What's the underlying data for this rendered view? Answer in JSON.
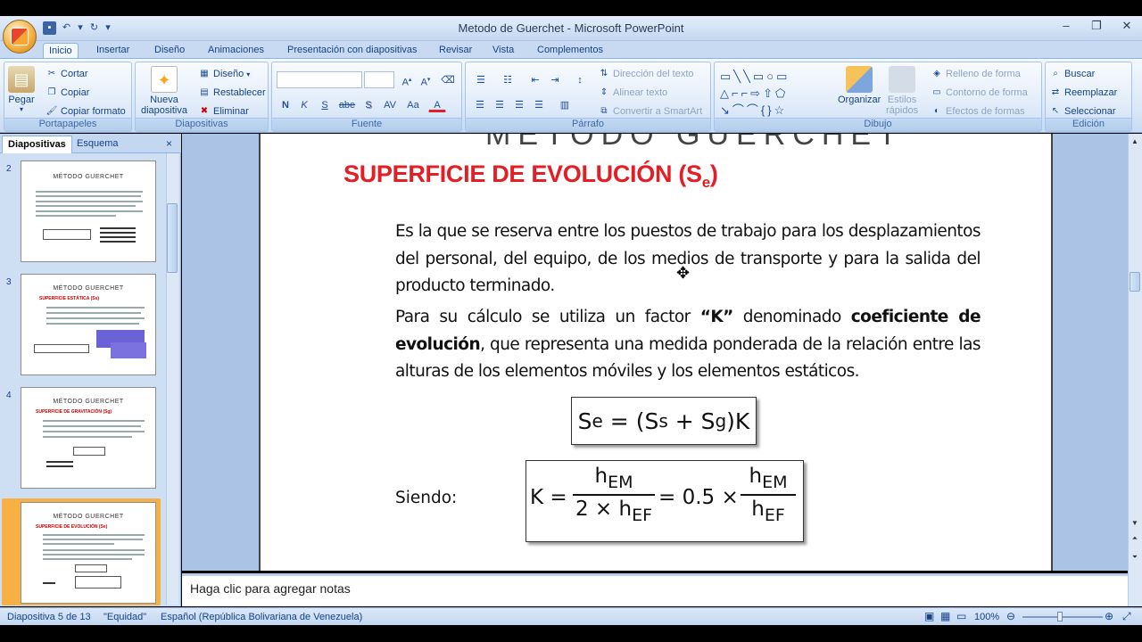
{
  "window": {
    "title": "Metodo de Guerchet - Microsoft PowerPoint"
  },
  "tabs": [
    "Inicio",
    "Insertar",
    "Diseño",
    "Animaciones",
    "Presentación con diapositivas",
    "Revisar",
    "Vista",
    "Complementos"
  ],
  "ribbon": {
    "portapapeles": {
      "label": "Portapapeles",
      "paste": "Pegar",
      "cut": "Cortar",
      "copy": "Copiar",
      "format_painter": "Copiar formato"
    },
    "diapositivas": {
      "label": "Diapositivas",
      "new_slide_line1": "Nueva",
      "new_slide_line2": "diapositiva",
      "layout": "Diseño",
      "reset": "Restablecer",
      "delete": "Eliminar"
    },
    "fuente": {
      "label": "Fuente",
      "bold": "N",
      "italic": "K",
      "underline": "S",
      "strike": "abe",
      "shadow": "S",
      "spacing": "AV",
      "case": "Aa",
      "color": "A"
    },
    "parrafo": {
      "label": "Párrafo",
      "text_direction": "Dirección del texto",
      "align_text": "Alinear texto",
      "smartart": "Convertir a SmartArt"
    },
    "dibujo": {
      "label": "Dibujo",
      "arrange": "Organizar",
      "quick_styles_1": "Estilos",
      "quick_styles_2": "rápidos",
      "fill": "Relleno de forma",
      "outline": "Contorno de forma",
      "effects": "Efectos de formas"
    },
    "edicion": {
      "label": "Edición",
      "find": "Buscar",
      "replace": "Reemplazar",
      "select": "Seleccionar"
    }
  },
  "left_pane": {
    "tabs": [
      "Diapositivas",
      "Esquema"
    ],
    "slides": [
      {
        "num": "2",
        "title": "MÉTODO GUERCHET",
        "subtitle": ""
      },
      {
        "num": "3",
        "title": "MÉTODO GUERCHET",
        "subtitle": "SUPERFICIE ESTÁTICA (Ss)"
      },
      {
        "num": "4",
        "title": "MÉTODO GUERCHET",
        "subtitle": "SUPERFICIE DE GRAVITACIÓN (Sg)"
      },
      {
        "num": "5",
        "title": "MÉTODO GUERCHET",
        "subtitle": "SUPERFICIE DE EVOLUCIÓN (Se)"
      }
    ]
  },
  "slide": {
    "title_main": "SUPERFICIE DE EVOLUCIÓN (S",
    "title_sub": "e",
    "title_close": ")",
    "old_title": "MÉTODO GUERCHET",
    "para1": "Es la que se reserva entre los puestos de trabajo para los desplazamientos del personal, del equipo, de los medios de transporte y para la salida del producto terminado.",
    "para2_a": "Para su cálculo se utiliza un factor ",
    "para2_k": "“K”",
    "para2_b": " denominado ",
    "para2_bold": "coeficiente de evolución",
    "para2_c": ", que representa una medida ponderada de la relación entre las alturas de los elementos móviles y los elementos estáticos.",
    "siendo": "Siendo:",
    "formula1": {
      "lhs": "S",
      "lhs_sub": "e",
      "eq": " = (S",
      "s_sub": "s",
      "plus": " + S",
      "g_sub": "g",
      "end": ")K"
    },
    "formula2": {
      "k": "K =",
      "num": "h",
      "num_sub": "EM",
      "den_a": "2 × h",
      "den_sub": "EF",
      "mid": "= 0.5 ×",
      "num2": "h",
      "num2_sub": "EM",
      "den2": "h",
      "den2_sub": "EF"
    }
  },
  "notes": {
    "placeholder": "Haga clic para agregar notas"
  },
  "status": {
    "slide": "Diapositiva 5 de 13",
    "theme": "\"Equidad\"",
    "language": "Español (República Bolivariana de Venezuela)",
    "zoom": "100%"
  }
}
